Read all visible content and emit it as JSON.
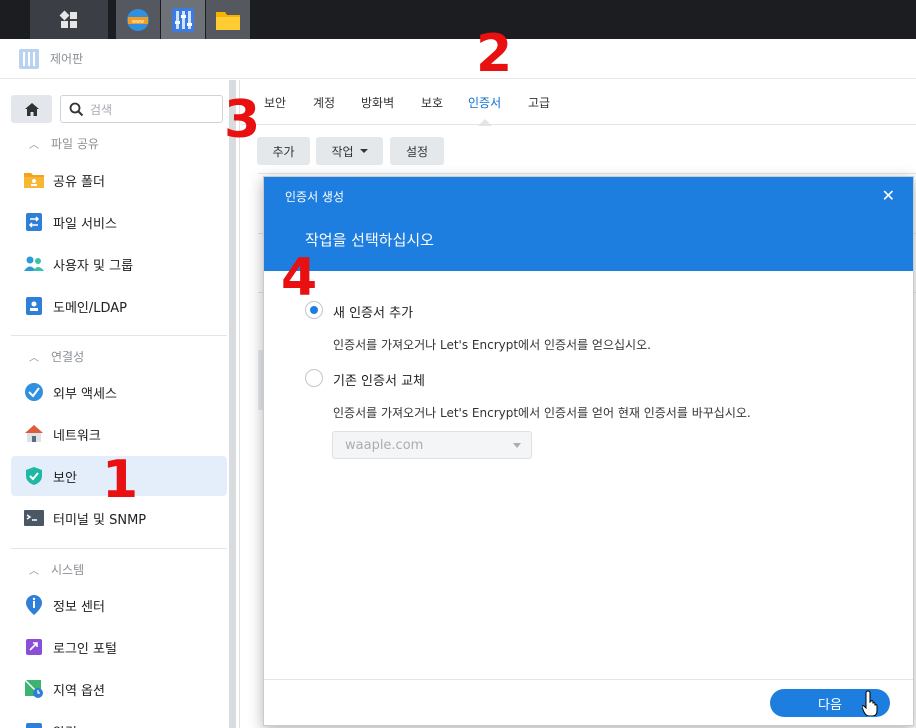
{
  "window": {
    "title": "제어판"
  },
  "sidebar": {
    "search_placeholder": "검색",
    "sections": [
      {
        "label": "파일 공유"
      },
      {
        "label": "연결성"
      },
      {
        "label": "시스템"
      }
    ],
    "items": [
      {
        "label": "공유 폴더",
        "icon": "folder-share-icon"
      },
      {
        "label": "파일 서비스",
        "icon": "file-services-icon"
      },
      {
        "label": "사용자 및 그룹",
        "icon": "users-icon"
      },
      {
        "label": "도메인/LDAP",
        "icon": "domain-icon"
      },
      {
        "label": "외부 액세스",
        "icon": "external-access-icon"
      },
      {
        "label": "네트워크",
        "icon": "network-icon"
      },
      {
        "label": "보안",
        "icon": "shield-icon",
        "active": true
      },
      {
        "label": "터미널 및 SNMP",
        "icon": "terminal-icon"
      },
      {
        "label": "정보 센터",
        "icon": "info-icon"
      },
      {
        "label": "로그인 포털",
        "icon": "login-portal-icon"
      },
      {
        "label": "지역 옵션",
        "icon": "regional-options-icon"
      },
      {
        "label": "알림",
        "icon": "notification-icon"
      }
    ]
  },
  "tabs": [
    {
      "label": "보안"
    },
    {
      "label": "계정"
    },
    {
      "label": "방화벽"
    },
    {
      "label": "보호"
    },
    {
      "label": "인증서",
      "active": true
    },
    {
      "label": "고급"
    }
  ],
  "toolbar": {
    "add": "추가",
    "action": "작업",
    "settings": "설정"
  },
  "dialog": {
    "title": "인증서 생성",
    "subtitle": "작업을 선택하십시오",
    "options": [
      {
        "label": "새 인증서 추가",
        "desc": "인증서를 가져오거나 Let's Encrypt에서 인증서를 얻으십시오.",
        "selected": true
      },
      {
        "label": "기존 인증서 교체",
        "desc": "인증서를 가져오거나 Let's Encrypt에서 인증서를 얻어 현재 인증서를 바꾸십시오.",
        "selected": false
      }
    ],
    "select_value": "waaple.com",
    "next": "다음"
  },
  "annotations": [
    "1",
    "2",
    "3",
    "4"
  ],
  "colors": {
    "accent": "#1e7ee0",
    "annotation": "#e81010"
  }
}
